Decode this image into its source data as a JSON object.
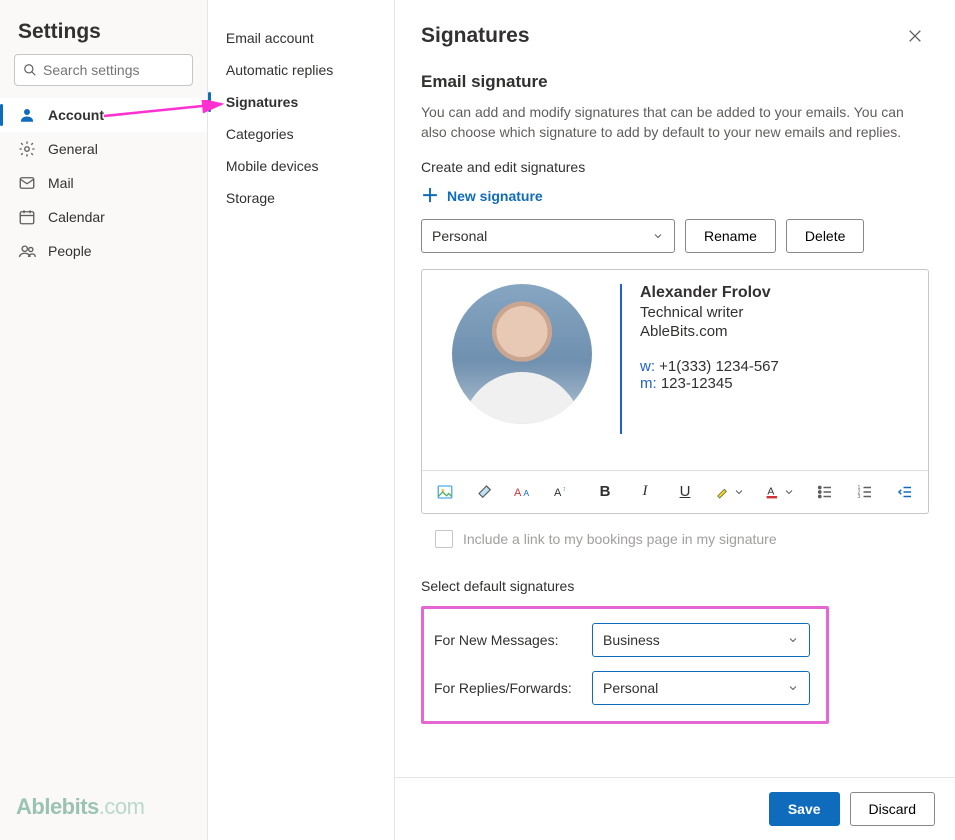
{
  "header": {
    "title": "Settings"
  },
  "search": {
    "placeholder": "Search settings"
  },
  "nav": [
    {
      "key": "account",
      "label": "Account",
      "active": true
    },
    {
      "key": "general",
      "label": "General",
      "active": false
    },
    {
      "key": "mail",
      "label": "Mail",
      "active": false
    },
    {
      "key": "calendar",
      "label": "Calendar",
      "active": false
    },
    {
      "key": "people",
      "label": "People",
      "active": false
    }
  ],
  "subnav": [
    {
      "label": "Email account",
      "active": false
    },
    {
      "label": "Automatic replies",
      "active": false
    },
    {
      "label": "Signatures",
      "active": true
    },
    {
      "label": "Categories",
      "active": false
    },
    {
      "label": "Mobile devices",
      "active": false
    },
    {
      "label": "Storage",
      "active": false
    }
  ],
  "panel": {
    "title": "Signatures",
    "section_title": "Email signature",
    "description": "You can add and modify signatures that can be added to your emails. You can also choose which signature to add by default to your new emails and replies.",
    "create_label": "Create and edit signatures",
    "new_signature": "New signature",
    "selected_signature": "Personal",
    "rename": "Rename",
    "delete": "Delete",
    "include_bookings": "Include a link to my bookings page in my signature",
    "defaults_title": "Select default signatures",
    "for_new_label": "For New Messages:",
    "for_new_value": "Business",
    "for_replies_label": "For Replies/Forwards:",
    "for_replies_value": "Personal",
    "save": "Save",
    "discard": "Discard"
  },
  "signature": {
    "name": "Alexander Frolov",
    "role": "Technical writer",
    "company": "AbleBits.com",
    "work_prefix": "w:",
    "work_phone": "+1(333) 1234-567",
    "mobile_prefix": "m:",
    "mobile_phone": "123-12345"
  },
  "branding": {
    "name": "Ablebits",
    "suffix": ".com"
  }
}
